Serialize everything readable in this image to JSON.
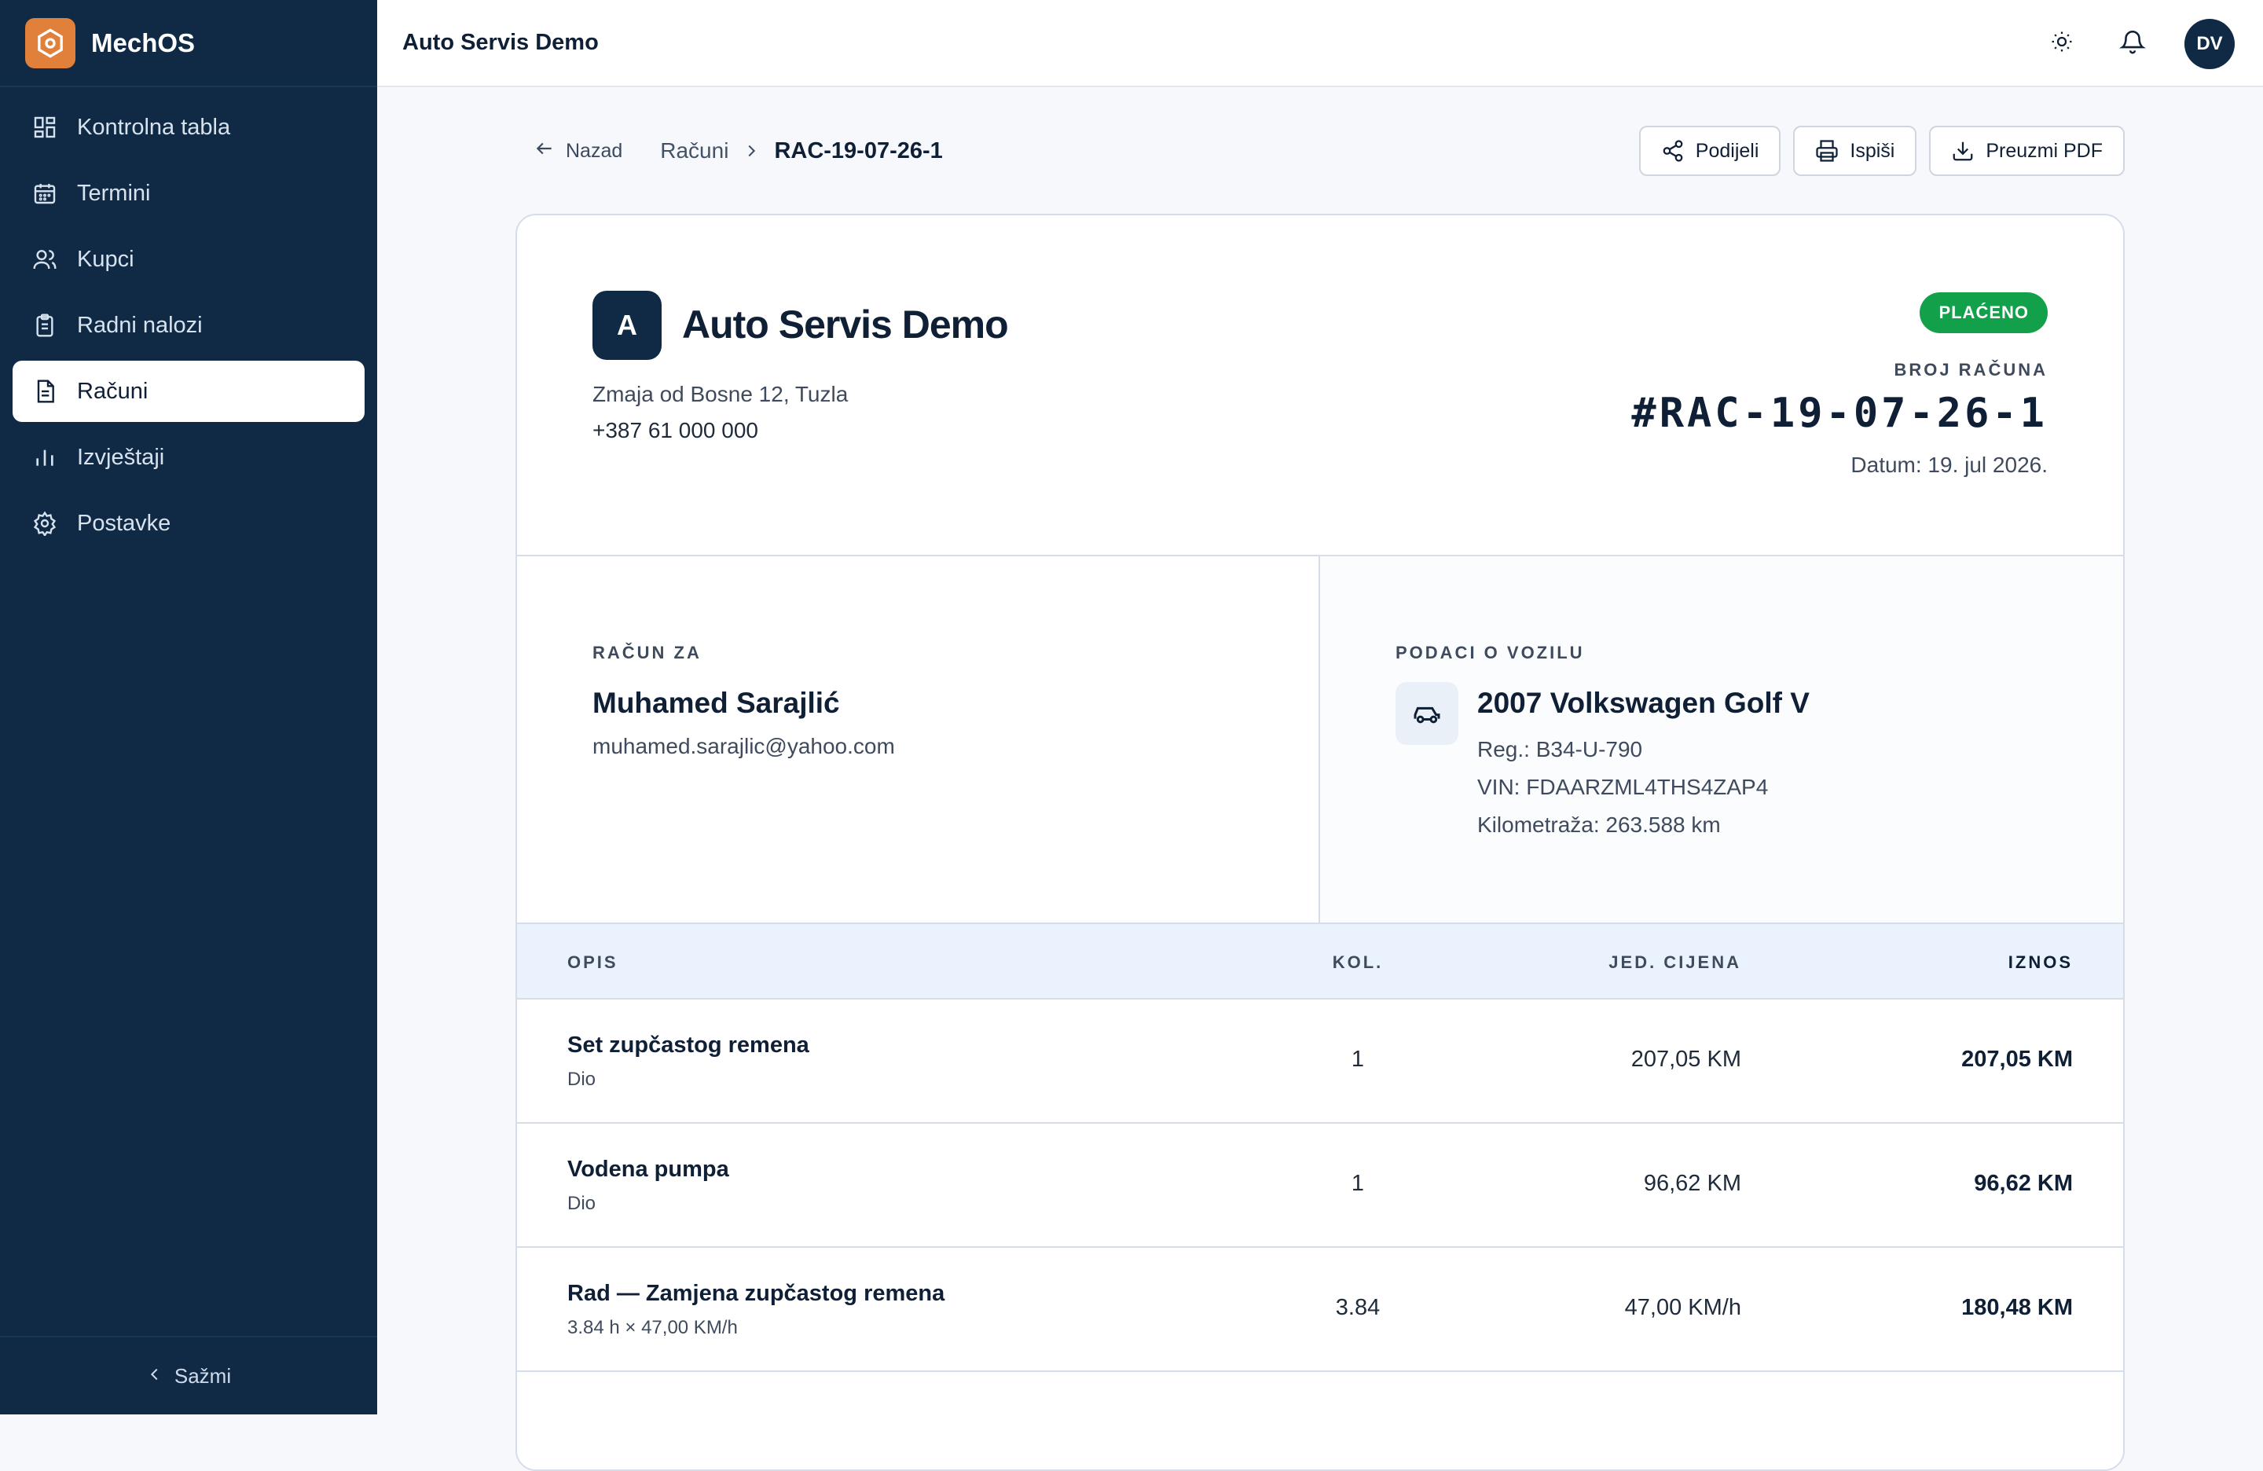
{
  "app": {
    "name": "MechOS"
  },
  "sidebar": {
    "items": [
      {
        "label": "Kontrolna tabla",
        "icon": "dashboard-icon",
        "active": false
      },
      {
        "label": "Termini",
        "icon": "calendar-icon",
        "active": false
      },
      {
        "label": "Kupci",
        "icon": "users-icon",
        "active": false
      },
      {
        "label": "Radni nalozi",
        "icon": "clipboard-icon",
        "active": false
      },
      {
        "label": "Računi",
        "icon": "invoice-icon",
        "active": true
      },
      {
        "label": "Izvještaji",
        "icon": "bar-chart-icon",
        "active": false
      },
      {
        "label": "Postavke",
        "icon": "gear-icon",
        "active": false
      }
    ],
    "collapse_label": "Sažmi"
  },
  "topbar": {
    "title": "Auto Servis Demo",
    "avatar_initials": "DV",
    "icons": [
      "sun-icon",
      "bell-icon"
    ]
  },
  "breadcrumb": {
    "back_label": "Nazad",
    "parent": "Računi",
    "current": "RAC-19-07-26-1"
  },
  "actions": {
    "share_label": "Podijeli",
    "print_label": "Ispiši",
    "pdf_label": "Preuzmi PDF"
  },
  "invoice": {
    "shop_initial": "A",
    "shop_name": "Auto Servis Demo",
    "shop_address": "Zmaja od Bosne 12, Tuzla",
    "shop_phone": "+387 61 000 000",
    "status": "PLAĆENO",
    "status_color": "#13a04a",
    "number_label": "BROJ RAČUNA",
    "number": "#RAC-19-07-26-1",
    "date": "Datum: 19. jul 2026.",
    "bill_to_label": "RAČUN ZA",
    "customer_name": "Muhamed Sarajlić",
    "customer_email": "muhamed.sarajlic@yahoo.com",
    "vehicle_label": "PODACI O VOZILU",
    "vehicle_title": "2007 Volkswagen Golf V",
    "vehicle_reg": "Reg.: B34-U-790",
    "vehicle_vin": "VIN: FDAARZML4THS4ZAP4",
    "vehicle_km": "Kilometraža: 263.588 km"
  },
  "table": {
    "headers": {
      "desc": "OPIS",
      "qty": "KOL.",
      "unit": "JED. CIJENA",
      "amount": "IZNOS"
    },
    "rows": [
      {
        "title": "Set zupčastog remena",
        "sub": "Dio",
        "qty": "1",
        "unit": "207,05 KM",
        "amount": "207,05 KM"
      },
      {
        "title": "Vodena pumpa",
        "sub": "Dio",
        "qty": "1",
        "unit": "96,62 KM",
        "amount": "96,62 KM"
      },
      {
        "title": "Rad — Zamjena zupčastog remena",
        "sub": "3.84 h × 47,00 KM/h",
        "qty": "3.84",
        "unit": "47,00 KM/h",
        "amount": "180,48 KM"
      }
    ]
  },
  "colors": {
    "sidebar_bg": "#102a45",
    "accent": "#e0803a",
    "table_head_bg": "#eaf2fd"
  }
}
